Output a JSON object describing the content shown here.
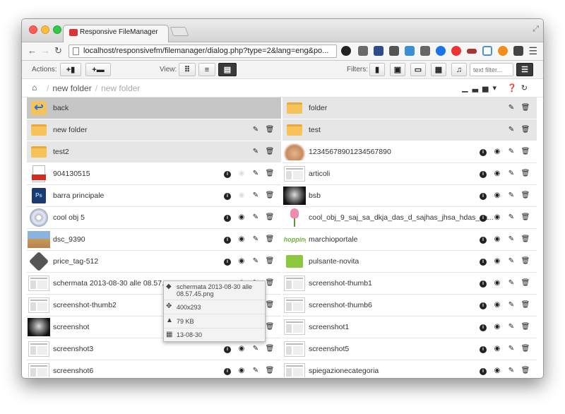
{
  "browser": {
    "tab_title": "Responsive FileManager",
    "url": "localhost/responsivefm/filemanager/dialog.php?type=2&lang=eng&po..."
  },
  "toolbar": {
    "actions_label": "Actions:",
    "view_label": "View:",
    "filters_label": "Filters:",
    "filter_placeholder": "text filter..."
  },
  "breadcrumb": {
    "items": [
      "new folder",
      "new folder"
    ]
  },
  "left_items": [
    {
      "name": "back",
      "thumb": "back-icon",
      "kind": "dir",
      "selected": true,
      "actions": false
    },
    {
      "name": "new folder",
      "thumb": "folder-icon",
      "kind": "dir",
      "actions": true
    },
    {
      "name": "test2",
      "thumb": "folder-icon",
      "kind": "dir",
      "actions": true
    },
    {
      "name": "904130515",
      "thumb": "pdf-icon",
      "kind": "file",
      "preview": false
    },
    {
      "name": "barra principale",
      "thumb": "psd-icon",
      "kind": "file",
      "preview": false
    },
    {
      "name": "cool obj 5",
      "thumb": "cd-icon",
      "kind": "file",
      "preview": true
    },
    {
      "name": "dsc_9390",
      "thumb": "photo-beach",
      "kind": "file",
      "preview": true
    },
    {
      "name": "price_tag-512",
      "thumb": "tag-icon",
      "kind": "file",
      "preview": true
    },
    {
      "name": "schermata 2013-08-30 alle 08.57.45",
      "thumb": "screenshot-thumb",
      "kind": "file",
      "preview": true
    },
    {
      "name": "screenshot-thumb2",
      "thumb": "screenshot-thumb",
      "kind": "file",
      "preview": true
    },
    {
      "name": "screenshot",
      "thumb": "photo-dark",
      "kind": "file",
      "preview": true
    },
    {
      "name": "screenshot3",
      "thumb": "screenshot-thumb",
      "kind": "file",
      "preview": true
    },
    {
      "name": "screenshot6",
      "thumb": "screenshot-thumb",
      "kind": "file",
      "preview": true
    }
  ],
  "right_items": [
    {
      "name": "folder",
      "thumb": "folder-icon",
      "kind": "dir",
      "actions": true
    },
    {
      "name": "test",
      "thumb": "folder-icon",
      "kind": "dir",
      "actions": true
    },
    {
      "name": "12345678901234567890",
      "thumb": "photo-thumbsup",
      "kind": "file",
      "preview": true
    },
    {
      "name": "articoli",
      "thumb": "screenshot-thumb",
      "kind": "file",
      "preview": true
    },
    {
      "name": "bsb",
      "thumb": "photo-dark",
      "kind": "file",
      "preview": true
    },
    {
      "name": "cool_obj_9_saj_sa_dkja_das_d_sajhas_jhsa_hdas_sa...",
      "thumb": "tulip-icon",
      "kind": "file",
      "preview": true
    },
    {
      "name": "marchioportale",
      "thumb": "shopping-logo",
      "kind": "file",
      "preview": true
    },
    {
      "name": "pulsante-novita",
      "thumb": "green-button",
      "kind": "file",
      "preview": true
    },
    {
      "name": "screenshot-thumb1",
      "thumb": "screenshot-thumb",
      "kind": "file",
      "preview": true
    },
    {
      "name": "screenshot-thumb6",
      "thumb": "screenshot-thumb",
      "kind": "file",
      "preview": true
    },
    {
      "name": "screenshot1",
      "thumb": "screenshot-thumb",
      "kind": "file",
      "preview": true
    },
    {
      "name": "screenshot5",
      "thumb": "screenshot-thumb",
      "kind": "file",
      "preview": true
    },
    {
      "name": "spiegazionecategoria",
      "thumb": "screenshot-thumb",
      "kind": "file",
      "preview": true
    }
  ],
  "shopping_logo_text": "shopping",
  "tooltip": {
    "filename": "schermata 2013-08-30 alle 08.57.45.png",
    "dimensions": "400x293",
    "size": "79 KB",
    "date": "13-08-30"
  }
}
